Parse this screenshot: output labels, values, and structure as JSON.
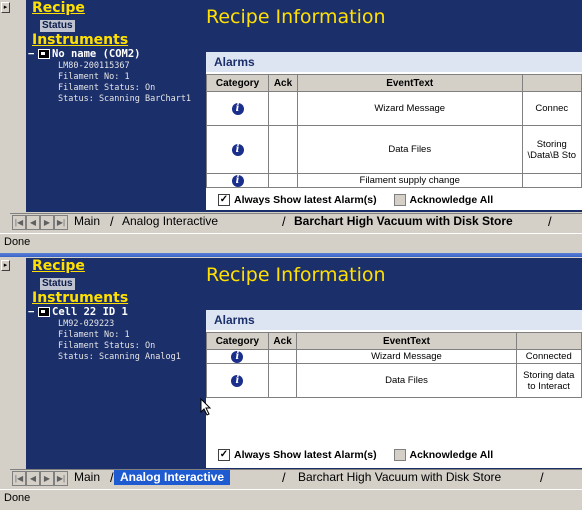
{
  "panes": [
    {
      "nav": {
        "recipe": "Recipe",
        "status": "Status",
        "instruments": "Instruments",
        "device_name": "No name (COM2)",
        "device_lines": [
          "LM80-200115367",
          "Filament No: 1",
          "Filament Status: On",
          "Status: Scanning BarChart1"
        ]
      },
      "title": "Recipe Information",
      "alarms_header": "Alarms",
      "columns": [
        "Category",
        "Ack",
        "EventText",
        ""
      ],
      "rows": [
        {
          "event": "Wizard Message",
          "extra": "Connec"
        },
        {
          "event": "Data Files",
          "extra": "Storing \\Data\\B Sto"
        },
        {
          "event": "Filament supply change",
          "extra": ""
        }
      ],
      "always_show": "Always Show latest Alarm(s)",
      "ack_all": "Acknowledge All",
      "tabs": [
        "Main",
        "Analog Interactive",
        "Barchart High Vacuum with Disk Store"
      ],
      "status": "Done"
    },
    {
      "nav": {
        "recipe": "Recipe",
        "status": "Status",
        "instruments": "Instruments",
        "device_name": "Cell 22 ID 1",
        "device_lines": [
          "LM92-029223",
          "Filament No: 1",
          "Filament Status: On",
          "Status: Scanning Analog1"
        ]
      },
      "title": "Recipe Information",
      "alarms_header": "Alarms",
      "columns": [
        "Category",
        "Ack",
        "EventText",
        ""
      ],
      "rows": [
        {
          "event": "Wizard Message",
          "extra": "Connected"
        },
        {
          "event": "Data Files",
          "extra": "Storing data to Interact"
        }
      ],
      "always_show": "Always Show latest Alarm(s)",
      "ack_all": "Acknowledge All",
      "tabs": [
        "Main",
        "Analog Interactive",
        "Barchart High Vacuum with Disk Store"
      ],
      "status": "Done"
    }
  ],
  "icons": {
    "info": "info-icon",
    "device": "device-icon",
    "tree_toggle": "tree-collapse-icon",
    "first": "first-tab-icon",
    "prev": "prev-tab-icon",
    "next": "next-tab-icon",
    "last": "last-tab-icon"
  },
  "colors": {
    "nav_bg": "#1b2f6a",
    "title": "#ffe000",
    "selected_tab": "#1f5bd0"
  }
}
